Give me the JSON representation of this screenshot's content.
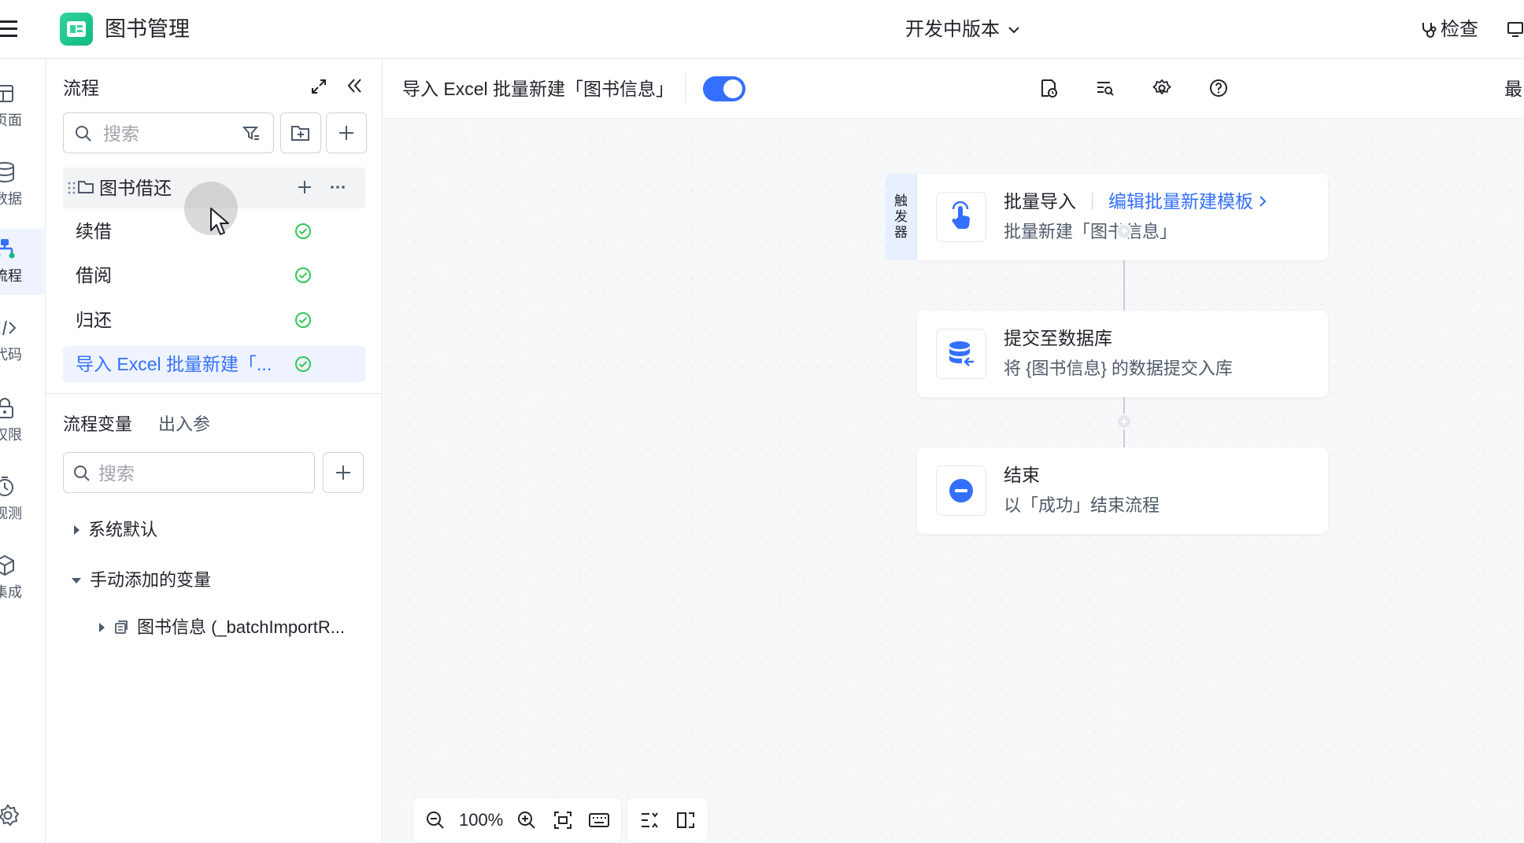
{
  "app": {
    "title": "图书管理",
    "version_label": "开发中版本",
    "check_label": "检查"
  },
  "rail": {
    "items": [
      {
        "label": "页面",
        "icon": "page-icon"
      },
      {
        "label": "数据",
        "icon": "database-icon"
      },
      {
        "label": "流程",
        "icon": "flow-icon",
        "active": true
      },
      {
        "label": "代码",
        "icon": "code-icon"
      },
      {
        "label": "权限",
        "icon": "lock-icon"
      },
      {
        "label": "观测",
        "icon": "monitor-icon"
      },
      {
        "label": "集成",
        "icon": "cube-icon"
      }
    ]
  },
  "panel": {
    "title": "流程",
    "search_placeholder": "搜索",
    "group": {
      "label": "图书借还"
    },
    "flows": [
      {
        "label": "续借",
        "status": "ok"
      },
      {
        "label": "借阅",
        "status": "ok"
      },
      {
        "label": "归还",
        "status": "ok"
      },
      {
        "label": "导入 Excel 批量新建「...",
        "status": "ok",
        "selected": true
      }
    ],
    "var_tabs": [
      "流程变量",
      "出入参"
    ],
    "var_search_placeholder": "搜索",
    "tree": {
      "system": "系统默认",
      "manual": "手动添加的变量",
      "manual_child": "图书信息 (_batchImportR..."
    }
  },
  "canvas": {
    "flow_title": "导入 Excel 批量新建「图书信息」",
    "enabled": true,
    "toolbar_more": "最",
    "trigger_tag": [
      "触",
      "发",
      "器"
    ],
    "nodes": [
      {
        "title": "批量导入",
        "link": "编辑批量新建模板",
        "desc": "批量新建「图书信息」",
        "icon": "hand-pointer-icon"
      },
      {
        "title": "提交至数据库",
        "desc": "将 {图书信息} 的数据提交入库",
        "icon": "database-submit-icon"
      },
      {
        "title": "结束",
        "desc": "以「成功」结束流程",
        "icon": "minus-circle-icon"
      }
    ],
    "zoom": "100%"
  },
  "colors": {
    "accent": "#3370ff",
    "success": "#34c759",
    "logo": "#10b981"
  }
}
